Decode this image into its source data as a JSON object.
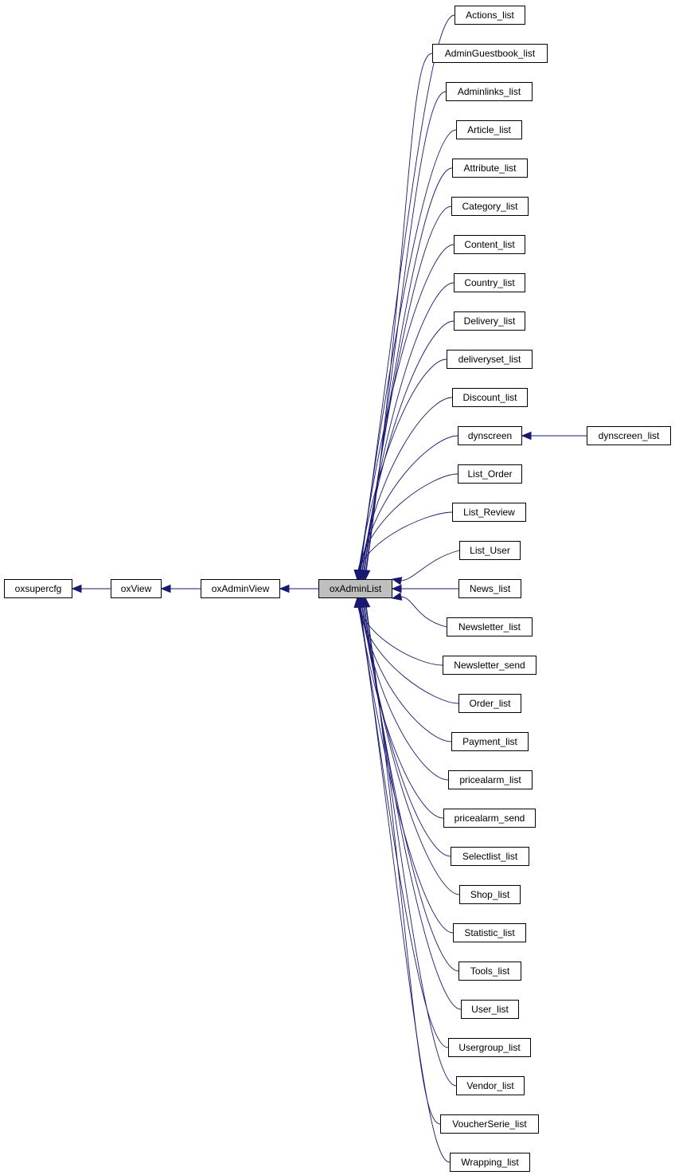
{
  "colors": {
    "edge": "#191970",
    "current_fill": "#bfbfbf",
    "node_fill": "#ffffff",
    "border": "#000000"
  },
  "chain": [
    {
      "id": "oxsupercfg",
      "label": "oxsupercfg"
    },
    {
      "id": "oxView",
      "label": "oxView"
    },
    {
      "id": "oxAdminView",
      "label": "oxAdminView"
    },
    {
      "id": "oxAdminList",
      "label": "oxAdminList",
      "current": true
    }
  ],
  "children": [
    {
      "label": "Actions_list"
    },
    {
      "label": "AdminGuestbook_list"
    },
    {
      "label": "Adminlinks_list"
    },
    {
      "label": "Article_list"
    },
    {
      "label": "Attribute_list"
    },
    {
      "label": "Category_list"
    },
    {
      "label": "Content_list"
    },
    {
      "label": "Country_list"
    },
    {
      "label": "Delivery_list"
    },
    {
      "label": "deliveryset_list"
    },
    {
      "label": "Discount_list"
    },
    {
      "label": "dynscreen"
    },
    {
      "label": "List_Order"
    },
    {
      "label": "List_Review"
    },
    {
      "label": "List_User"
    },
    {
      "label": "News_list"
    },
    {
      "label": "Newsletter_list"
    },
    {
      "label": "Newsletter_send"
    },
    {
      "label": "Order_list"
    },
    {
      "label": "Payment_list"
    },
    {
      "label": "pricealarm_list"
    },
    {
      "label": "pricealarm_send"
    },
    {
      "label": "Selectlist_list"
    },
    {
      "label": "Shop_list"
    },
    {
      "label": "Statistic_list"
    },
    {
      "label": "Tools_list"
    },
    {
      "label": "User_list"
    },
    {
      "label": "Usergroup_list"
    },
    {
      "label": "Vendor_list"
    },
    {
      "label": "VoucherSerie_list"
    },
    {
      "label": "Wrapping_list"
    }
  ],
  "grandchild": {
    "label": "dynscreen_list",
    "parent": "dynscreen"
  }
}
